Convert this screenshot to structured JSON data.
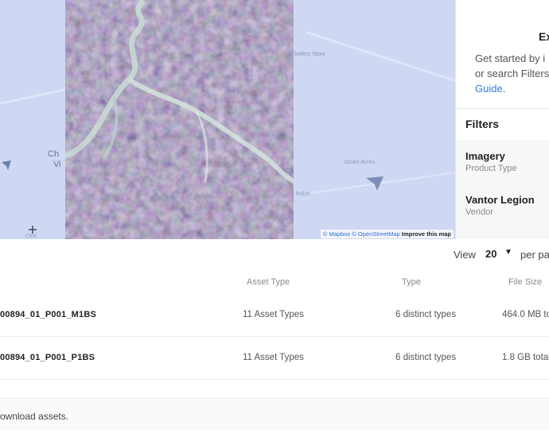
{
  "map": {
    "labels": [
      "Sellers Store",
      "Ozark Acres",
      "Baker",
      "Ch",
      "Vi",
      "CKK"
    ],
    "attribution": {
      "mapbox": "© Mapbox",
      "osm": "© OpenStreetMap",
      "improve": "Improve this map"
    }
  },
  "panel": {
    "title": "Ex",
    "desc_line1": "Get started by i",
    "desc_line2": "or search Filters",
    "desc_link": "Guide",
    "desc_period": ".",
    "filters_title": "Filters",
    "filters": [
      {
        "name": "Imagery",
        "sub": "Product Type"
      },
      {
        "name": "Vantor Legion",
        "sub": "Vendor"
      }
    ]
  },
  "table": {
    "view_label": "View",
    "view_value": "20",
    "view_suffix": "per pa",
    "headers": {
      "asset_type": "Asset Type",
      "type": "Type",
      "file_size": "File Size"
    },
    "rows": [
      {
        "name": "00894_01_P001_M1BS",
        "asset_type": "11 Asset Types",
        "type": "6 distinct types",
        "file_size": "464.0 MB to"
      },
      {
        "name": "00894_01_P001_P1BS",
        "asset_type": "11 Asset Types",
        "type": "6 distinct types",
        "file_size": "1.8 GB total"
      }
    ]
  },
  "footer": {
    "text": "ownload assets."
  },
  "colors": {
    "map_bg": "#cfd8f2",
    "link": "#2b7bdd"
  }
}
